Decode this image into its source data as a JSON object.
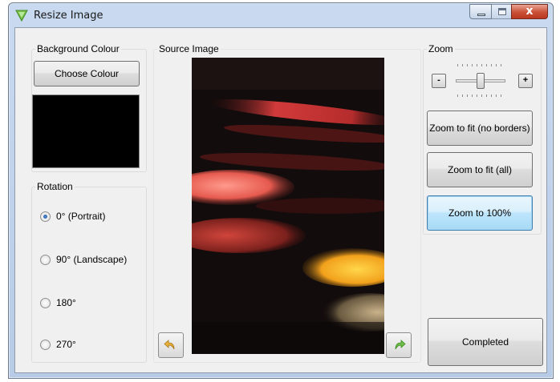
{
  "window": {
    "title": "Resize Image",
    "controls": {
      "minimize": "minimize",
      "maximize": "maximize",
      "close": "x"
    }
  },
  "background_colour": {
    "legend": "Background Colour",
    "choose_button": "Choose Colour",
    "swatch_color": "#000000"
  },
  "rotation": {
    "legend": "Rotation",
    "options": [
      {
        "label": "0° (Portrait)",
        "checked": true
      },
      {
        "label": "90° (Landscape)",
        "checked": false
      },
      {
        "label": "180°",
        "checked": false
      },
      {
        "label": "270°",
        "checked": false
      }
    ]
  },
  "source_image": {
    "legend": "Source Image",
    "rotate_left_icon": "rotate-left-icon",
    "rotate_right_icon": "rotate-right-icon"
  },
  "zoom": {
    "legend": "Zoom",
    "minus": "-",
    "plus": "+",
    "slider_level": 0.5,
    "buttons": {
      "fit_no_borders": "Zoom to fit (no borders)",
      "fit_all": "Zoom to fit (all)",
      "hundred": "Zoom to 100%"
    }
  },
  "completed_button": "Completed",
  "colors": {
    "accent_focus": "#3c7fb1",
    "window_frame": "#b7cbe6",
    "close_red": "#c94f35"
  }
}
